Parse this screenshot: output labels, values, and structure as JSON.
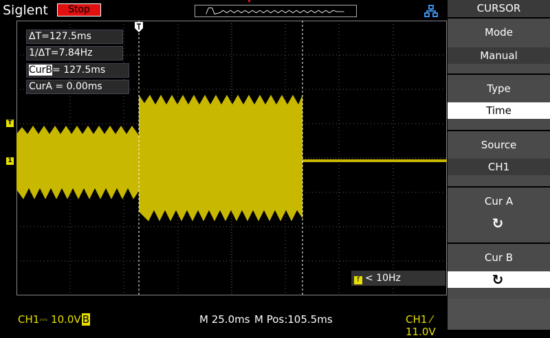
{
  "header": {
    "brand": "Siglent",
    "run_state": "Stop"
  },
  "cursors": {
    "delta_t": "ΔT=127.5ms",
    "inv_delta_t": "1/ΔT=7.84Hz",
    "cur_b_label": "CurB",
    "cur_b_value": "= 127.5ms",
    "cur_a": "CurA = 0.00ms"
  },
  "trigger_freq": {
    "icon": "f",
    "text": "< 10Hz"
  },
  "markers": {
    "trigger_level": "T",
    "channel1": "1"
  },
  "status": {
    "ch1": "CH1⎓ 10.0V",
    "bw_flag": "B",
    "timebase": "M 25.0ms",
    "mpos": "M Pos:105.5ms",
    "trigger": "CH1 ⁄ 11.0V"
  },
  "menu": {
    "title": "CURSOR",
    "mode": {
      "label": "Mode",
      "value": "Manual"
    },
    "type": {
      "label": "Type",
      "value": "Time"
    },
    "source": {
      "label": "Source",
      "value": "CH1"
    },
    "cur_a": {
      "label": "Cur A"
    },
    "cur_b": {
      "label": "Cur B"
    }
  },
  "colors": {
    "trace": "#c8b800",
    "stop": "#e01010",
    "menu_bg": "#505050"
  }
}
